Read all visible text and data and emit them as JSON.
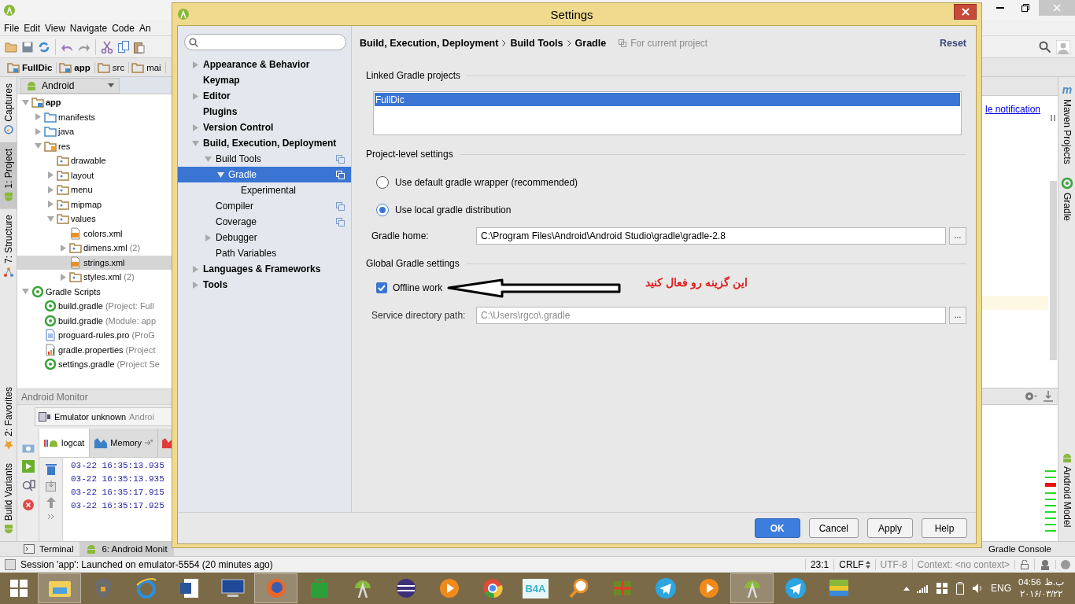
{
  "ide": {
    "menu": [
      "File",
      "Edit",
      "View",
      "Navigate",
      "Code",
      "An"
    ],
    "breadcrumbs": [
      {
        "label": "FullDic",
        "kind": "module"
      },
      {
        "label": "app",
        "kind": "module"
      },
      {
        "label": "src",
        "kind": "folder"
      },
      {
        "label": "mai",
        "kind": "folder"
      }
    ],
    "left_tools": [
      {
        "label": "Captures",
        "kind": "captures",
        "selected": false
      },
      {
        "label": "1: Project",
        "kind": "android",
        "selected": true
      },
      {
        "label": "7: Structure",
        "kind": "structure",
        "selected": false
      }
    ],
    "left_tools_bottom": [
      {
        "label": "2: Favorites",
        "kind": "star",
        "selected": false
      },
      {
        "label": "Build Variants",
        "kind": "android",
        "selected": false
      }
    ],
    "project_view": "Android",
    "project_tree": [
      {
        "label": "app",
        "kind": "module",
        "expanded": true,
        "selected": false,
        "children": [
          {
            "label": "manifests",
            "kind": "source",
            "expanded": false,
            "selected": false
          },
          {
            "label": "java",
            "kind": "source",
            "expanded": false,
            "selected": false
          },
          {
            "label": "res",
            "kind": "res",
            "expanded": true,
            "selected": false,
            "children": [
              {
                "label": "drawable",
                "kind": "resdir",
                "selected": false
              },
              {
                "label": "layout",
                "kind": "resdir",
                "expanded": false,
                "selected": false
              },
              {
                "label": "menu",
                "kind": "resdir",
                "expanded": false,
                "selected": false
              },
              {
                "label": "mipmap",
                "kind": "resdir",
                "expanded": false,
                "selected": false
              },
              {
                "label": "values",
                "kind": "resdir",
                "expanded": true,
                "selected": false,
                "children": [
                  {
                    "label": "colors.xml",
                    "kind": "xml",
                    "selected": false
                  },
                  {
                    "label": "dimens.xml",
                    "note": "(2)",
                    "kind": "resdir",
                    "expanded": false,
                    "selected": false
                  },
                  {
                    "label": "strings.xml",
                    "kind": "xml",
                    "selected": true
                  },
                  {
                    "label": "styles.xml",
                    "note": "(2)",
                    "kind": "resdir",
                    "expanded": false,
                    "selected": false
                  }
                ]
              }
            ]
          }
        ]
      },
      {
        "label": "Gradle Scripts",
        "kind": "gradle",
        "expanded": true,
        "selected": false,
        "children": [
          {
            "label": "build.gradle",
            "note": "(Project: Full",
            "kind": "gradle",
            "selected": false
          },
          {
            "label": "build.gradle",
            "note": "(Module: app",
            "kind": "gradle",
            "selected": false
          },
          {
            "label": "proguard-rules.pro",
            "note": "(ProG",
            "kind": "text",
            "selected": false
          },
          {
            "label": "gradle.properties",
            "note": "(Project",
            "kind": "properties",
            "selected": false
          },
          {
            "label": "settings.gradle",
            "note": "(Project Se",
            "kind": "gradle",
            "selected": false
          }
        ]
      }
    ],
    "monitor": {
      "title": "Android Monitor",
      "device": "Emulator unknown",
      "device_note": "Androi",
      "tabs": [
        {
          "label": "logcat",
          "kind": "logcat",
          "selected": true
        },
        {
          "label": "Memory",
          "kind": "memory",
          "selected": false
        },
        {
          "kind": "cpu",
          "selected": false
        }
      ],
      "log": [
        "03-22 16:35:13.935",
        "03-22 16:35:13.935",
        "03-22 16:35:17.915",
        "03-22 16:35:17.925"
      ]
    },
    "notification_link": "le notification",
    "right_tools": [
      {
        "label": "Maven Projects",
        "kind": "maven",
        "icon_text": "m"
      },
      {
        "label": "Gradle",
        "kind": "gradle"
      }
    ],
    "right_tools_bottom": [
      {
        "label": "Android Model",
        "kind": "android"
      }
    ],
    "bottom_tabs": [
      {
        "label": "Terminal",
        "kind": "terminal",
        "selected": false
      },
      {
        "label": "6: Android Monit",
        "kind": "android",
        "selected": true
      }
    ],
    "bottom_tabs_right": [
      {
        "label": "Gradle Console",
        "selected": false
      }
    ],
    "status": {
      "message": "Session 'app': Launched on emulator-5554 (20 minutes ago)",
      "position": "23:1",
      "line_separator": "CRLF",
      "encoding": "UTF-8",
      "context": "Context: <no context>"
    }
  },
  "settings": {
    "title": "Settings",
    "tree": [
      {
        "label": "Appearance & Behavior",
        "expanded": false,
        "selected": false,
        "scoped": false
      },
      {
        "label": "Keymap",
        "selected": false,
        "scoped": false
      },
      {
        "label": "Editor",
        "expanded": false,
        "selected": false,
        "scoped": false
      },
      {
        "label": "Plugins",
        "selected": false,
        "scoped": false
      },
      {
        "label": "Version Control",
        "expanded": false,
        "selected": false,
        "scoped": false
      },
      {
        "label": "Build, Execution, Deployment",
        "expanded": true,
        "selected": false,
        "scoped": false,
        "children": [
          {
            "label": "Build Tools",
            "expanded": true,
            "selected": false,
            "scoped": true,
            "children": [
              {
                "label": "Gradle",
                "expanded": true,
                "selected": true,
                "scoped": true,
                "children": [
                  {
                    "label": "Experimental",
                    "selected": false,
                    "scoped": false
                  }
                ]
              }
            ]
          },
          {
            "label": "Compiler",
            "selected": false,
            "scoped": true
          },
          {
            "label": "Coverage",
            "selected": false,
            "scoped": true
          },
          {
            "label": "Debugger",
            "expanded": false,
            "selected": false,
            "scoped": false
          },
          {
            "label": "Path Variables",
            "selected": false,
            "scoped": false
          }
        ]
      },
      {
        "label": "Languages & Frameworks",
        "expanded": false,
        "selected": false,
        "scoped": false
      },
      {
        "label": "Tools",
        "expanded": false,
        "selected": false,
        "scoped": false
      }
    ],
    "path": [
      "Build, Execution, Deployment",
      "Build Tools",
      "Gradle"
    ],
    "scope": "For current project",
    "reset": "Reset",
    "linked_title": "Linked Gradle projects",
    "linked_projects": [
      {
        "label": "FullDic",
        "selected": true
      }
    ],
    "project_title": "Project-level settings",
    "distribution": [
      {
        "label": "Use default gradle wrapper (recommended)",
        "selected": false
      },
      {
        "label": "Use local gradle distribution",
        "selected": true
      }
    ],
    "gradle_home": {
      "label": "Gradle home:",
      "value": "C:\\Program Files\\Android\\Android Studio\\gradle\\gradle-2.8",
      "browse": "...",
      "disabled": false
    },
    "global_title": "Global Gradle settings",
    "offline": {
      "label": "Offline work",
      "checked": true
    },
    "annotation": "این گزینه رو فعال کنید",
    "service_path": {
      "label": "Service directory path:",
      "value": "C:\\Users\\rgco\\.gradle",
      "browse": "...",
      "disabled": true
    },
    "buttons": [
      {
        "label": "OK",
        "kind": "primary"
      },
      {
        "label": "Cancel",
        "kind": "default"
      },
      {
        "label": "Apply",
        "kind": "default"
      },
      {
        "label": "Help",
        "kind": "default"
      }
    ]
  },
  "taskbar": {
    "apps": [
      {
        "kind": "explorer",
        "selected": true
      },
      {
        "kind": "shield",
        "selected": false
      },
      {
        "kind": "browser-e",
        "selected": false
      },
      {
        "kind": "word",
        "selected": false
      },
      {
        "kind": "monitor",
        "selected": false
      },
      {
        "kind": "firefox",
        "selected": true
      },
      {
        "kind": "store",
        "selected": false
      },
      {
        "kind": "studio",
        "selected": false
      },
      {
        "kind": "eclipse",
        "selected": false
      },
      {
        "kind": "player",
        "selected": false
      },
      {
        "kind": "chrome",
        "selected": false
      },
      {
        "kind": "b4a",
        "label": "B4A",
        "selected": false
      },
      {
        "kind": "magnifier",
        "selected": false
      },
      {
        "kind": "puzzle",
        "selected": false
      },
      {
        "kind": "telegram",
        "selected": false
      },
      {
        "kind": "player",
        "selected": false
      },
      {
        "kind": "studio",
        "selected": true
      },
      {
        "kind": "telegram",
        "selected": false
      },
      {
        "kind": "stack",
        "selected": false
      }
    ],
    "language": "ENG",
    "time": "04:56",
    "period": "ب.ظ",
    "date": "۲۰۱۶/۰۳/۲۲"
  }
}
